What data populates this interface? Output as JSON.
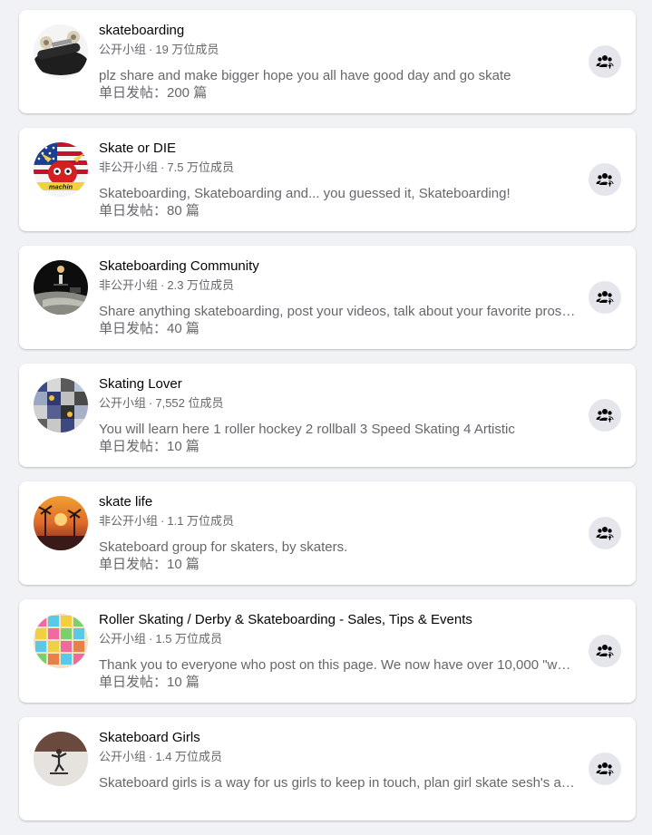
{
  "groups": [
    {
      "name": "skateboarding",
      "privacy": "公开小组",
      "members": "19 万位成员",
      "description": "plz share and make bigger hope you all have good day and go skate",
      "posts": "单日发帖：200 篇",
      "avatar": "skateboard-avatar"
    },
    {
      "name": "Skate or DIE",
      "privacy": "非公开小组",
      "members": "7.5 万位成员",
      "description": "Skateboarding, Skateboarding and... you guessed it, Skateboarding!",
      "posts": "单日发帖：80 篇",
      "avatar": "flag-bull-avatar",
      "avatar_text": "machin"
    },
    {
      "name": "Skateboarding Community",
      "privacy": "非公开小组",
      "members": "2.3 万位成员",
      "description": "Share anything skateboarding, post your videos, talk about your favorite pros, and meet new skate buddies!",
      "posts": "单日发帖：40 篇",
      "avatar": "skatepark-night-avatar"
    },
    {
      "name": "Skating Lover",
      "privacy": "公开小组",
      "members": "7,552 位成员",
      "description": "You will learn here 1 roller hockey 2 rollball 3 Speed Skating 4 Artistic",
      "posts": "单日发帖：10 篇",
      "avatar": "skates-collage-avatar"
    },
    {
      "name": "skate life",
      "privacy": "非公开小组",
      "members": "1.1 万位成员",
      "description": "Skateboard group for skaters, by skaters.",
      "posts": "单日发帖：10 篇",
      "avatar": "sunset-palms-avatar"
    },
    {
      "name": "Roller Skating / Derby & Skateboarding - Sales, Tips & Events",
      "privacy": "公开小组",
      "members": "1.5 万位成员",
      "description": "Thank you to everyone who post on this page. We now have over 10,000 \"who love roller skating\" members",
      "posts": "单日发帖：10 篇",
      "avatar": "colorful-grid-avatar"
    },
    {
      "name": "Skateboard Girls",
      "privacy": "公开小组",
      "members": "1.4 万位成员",
      "description": "Skateboard girls is a way for us girls to keep in touch, plan girl skate sesh's and share videos",
      "posts": "",
      "avatar": "skater-girl-avatar"
    }
  ],
  "meta_separator": "·",
  "join_icon": "group-join-icon",
  "colors": {
    "page_bg": "#f0f2f5",
    "card_bg": "#ffffff",
    "secondary_text": "#65676b",
    "button_bg": "#e4e6eb"
  }
}
